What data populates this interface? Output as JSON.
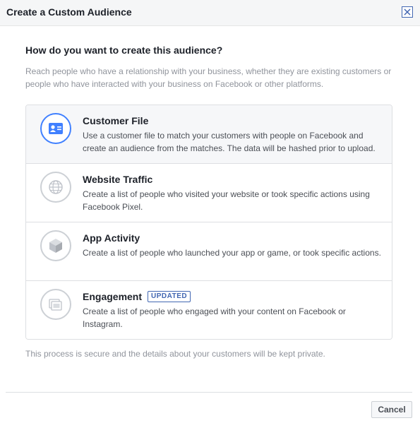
{
  "dialog": {
    "title": "Create a Custom Audience",
    "close_icon": "close-icon"
  },
  "question": "How do you want to create this audience?",
  "intro": "Reach people who have a relationship with your business, whether they are existing customers or people who have interacted with your business on Facebook or other platforms.",
  "options": [
    {
      "title": "Customer File",
      "description": "Use a customer file to match your customers with people on Facebook and create an audience from the matches. The data will be hashed prior to upload.",
      "icon": "contact-card-icon",
      "selected": true
    },
    {
      "title": "Website Traffic",
      "description": "Create a list of people who visited your website or took specific actions using Facebook Pixel.",
      "icon": "globe-icon",
      "selected": false
    },
    {
      "title": "App Activity",
      "description": "Create a list of people who launched your app or game, or took specific actions.",
      "icon": "cube-icon",
      "selected": false
    },
    {
      "title": "Engagement",
      "badge": "UPDATED",
      "description": "Create a list of people who engaged with your content on Facebook or Instagram.",
      "icon": "stacked-posts-icon",
      "selected": false
    }
  ],
  "footnote": "This process is secure and the details about your customers will be kept private.",
  "footer": {
    "cancel_label": "Cancel"
  },
  "colors": {
    "accent": "#4080ff",
    "brand_blue": "#4267b2",
    "muted_text": "#90949c",
    "border": "#dddfe2"
  }
}
